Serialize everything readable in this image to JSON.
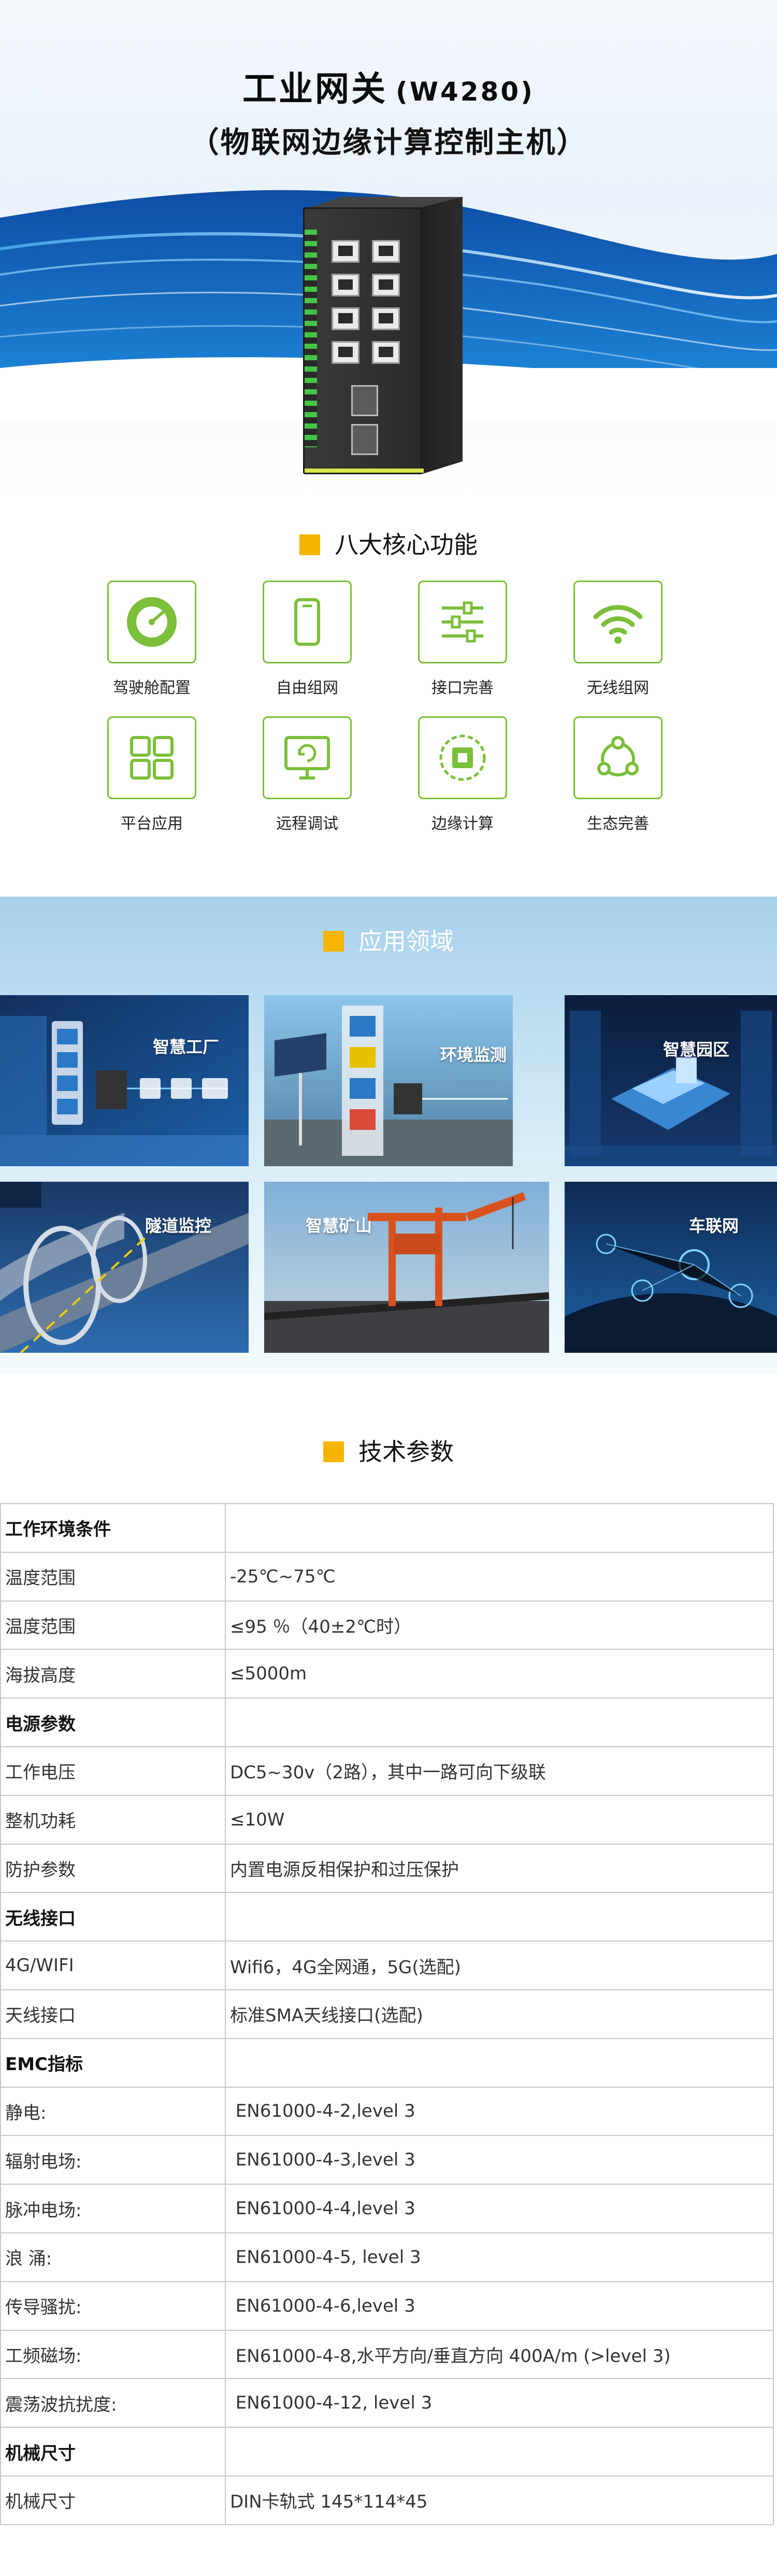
{
  "hero": {
    "title": "工业网关",
    "model": "(W4280)",
    "subtitle": "（物联网边缘计算控制主机）"
  },
  "features": {
    "heading": "八大核心功能",
    "items": [
      {
        "label": "驾驶舱配置",
        "icon": "gauge-icon"
      },
      {
        "label": "自由组网",
        "icon": "phone-icon"
      },
      {
        "label": "接口完善",
        "icon": "sliders-icon"
      },
      {
        "label": "无线组网",
        "icon": "wifi-icon"
      },
      {
        "label": "平台应用",
        "icon": "grid-icon"
      },
      {
        "label": "远程调试",
        "icon": "remote-icon"
      },
      {
        "label": "边缘计算",
        "icon": "chip-icon"
      },
      {
        "label": "生态完善",
        "icon": "ecosystem-icon"
      }
    ]
  },
  "applications": {
    "heading": "应用领域",
    "items": [
      {
        "label": "智慧工厂"
      },
      {
        "label": "环境监测"
      },
      {
        "label": "智慧园区"
      },
      {
        "label": "隧道监控"
      },
      {
        "label": "智慧矿山"
      },
      {
        "label": "车联网"
      }
    ]
  },
  "specs": {
    "heading": "技术参数",
    "rows": [
      {
        "key": "工作环境条件",
        "value": "",
        "group": true
      },
      {
        "key": "温度范围",
        "value": "-25℃~75℃"
      },
      {
        "key": "温度范围",
        "value": "≤95 ％（40±2℃时）"
      },
      {
        "key": "海拔高度",
        "value": "≤5000m"
      },
      {
        "key": "电源参数",
        "value": "",
        "group": true
      },
      {
        "key": "工作电压",
        "value": "DC5~30v（2路），其中一路可向下级联"
      },
      {
        "key": "整机功耗",
        "value": "≤10W"
      },
      {
        "key": "防护参数",
        "value": "内置电源反相保护和过压保护"
      },
      {
        "key": "无线接口",
        "value": "",
        "group": true
      },
      {
        "key": "4G/WIFI",
        "value": "Wifi6，4G全网通，5G(选配)"
      },
      {
        "key": "天线接口",
        "value": "标准SMA天线接口(选配)"
      },
      {
        "key": "EMC指标",
        "value": "",
        "group": true
      },
      {
        "key": "静电:",
        "value": " EN61000-4-2,level 3"
      },
      {
        "key": "辐射电场:",
        "value": " EN61000-4-3,level 3"
      },
      {
        "key": "脉冲电场:",
        "value": " EN61000-4-4,level 3"
      },
      {
        "key": "浪  涌:",
        "value": " EN61000-4-5, level 3"
      },
      {
        "key": "传导骚扰:",
        "value": " EN61000-4-6,level 3"
      },
      {
        "key": "工频磁场:",
        "value": " EN61000-4-8,水平方向/垂直方向 400A/m (>level 3)"
      },
      {
        "key": "震荡波抗扰度:",
        "value": " EN61000-4-12, level 3"
      },
      {
        "key": "机械尺寸",
        "value": "",
        "group": true
      },
      {
        "key": "机械尺寸",
        "value": "DIN卡轨式 145*114*45"
      }
    ]
  },
  "colors": {
    "accent": "#f5b400",
    "icon_green": "#7bbf3a",
    "hero_blue": "#1d6fc4"
  }
}
